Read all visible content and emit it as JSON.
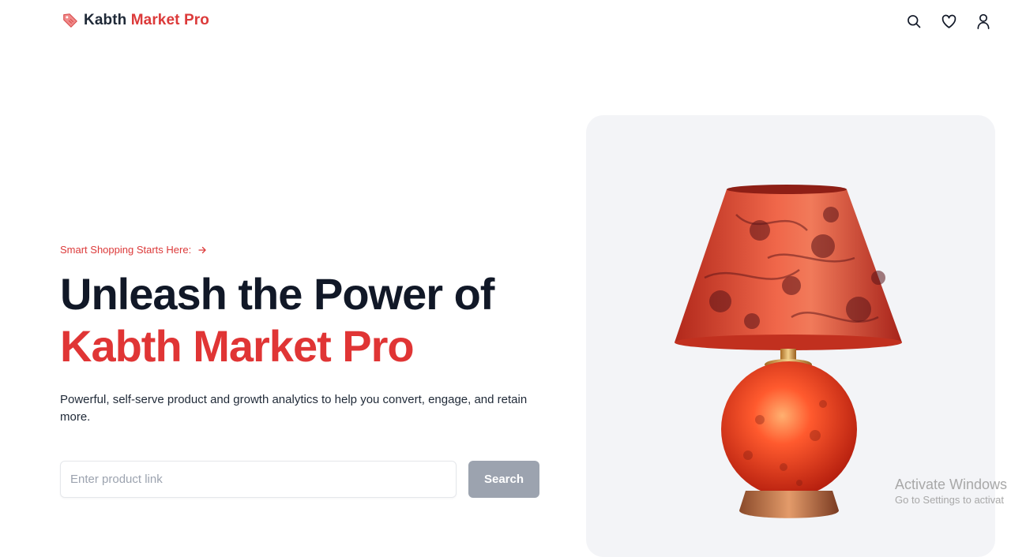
{
  "brand": {
    "name_part1": "Kabth",
    "name_part2": "Market Pro",
    "logo_icon": "price-tag-icon"
  },
  "nav": {
    "icons": [
      "search-icon",
      "heart-icon",
      "user-icon"
    ]
  },
  "hero": {
    "eyebrow": "Smart Shopping Starts Here:",
    "headline_line1": "Unleash the Power of",
    "headline_line2": "Kabth Market Pro",
    "subtitle": "Powerful, self-serve product and growth analytics to help you convert, engage, and retain more."
  },
  "search": {
    "placeholder": "Enter product link",
    "value": "",
    "button_label": "Search"
  },
  "watermark": {
    "line1": "Activate Windows",
    "line2": "Go to Settings to activat"
  },
  "colors": {
    "accent": "#dc3a3a",
    "dark": "#111827",
    "button_disabled": "#9ca3af",
    "card_bg": "#f3f4f7"
  }
}
